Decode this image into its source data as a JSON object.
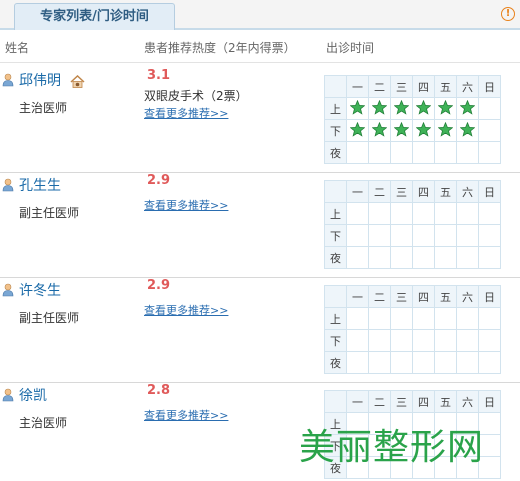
{
  "tab_label": "专家列表/门诊时间",
  "columns": {
    "name": "姓名",
    "rating": "患者推荐热度（2年内得票）",
    "clinic": "出诊时间"
  },
  "weekdays": [
    "一",
    "二",
    "三",
    "四",
    "五",
    "六",
    "日"
  ],
  "periods": [
    "上",
    "下",
    "夜"
  ],
  "more_link": "查看更多推荐>>",
  "doctors": [
    {
      "name": "邱伟明",
      "title": "主治医师",
      "score": "3.1",
      "votes": "双眼皮手术（2票）",
      "schedule": [
        [
          1,
          1,
          1,
          1,
          1,
          1,
          0
        ],
        [
          1,
          1,
          1,
          1,
          1,
          1,
          0
        ],
        [
          0,
          0,
          0,
          0,
          0,
          0,
          0
        ]
      ]
    },
    {
      "name": "孔生生",
      "title": "副主任医师",
      "score": "2.9",
      "votes": "",
      "schedule": [
        [
          0,
          0,
          0,
          0,
          0,
          0,
          0
        ],
        [
          0,
          0,
          0,
          0,
          0,
          0,
          0
        ],
        [
          0,
          0,
          0,
          0,
          0,
          0,
          0
        ]
      ]
    },
    {
      "name": "许冬生",
      "title": "副主任医师",
      "score": "2.9",
      "votes": "",
      "schedule": [
        [
          0,
          0,
          0,
          0,
          0,
          0,
          0
        ],
        [
          0,
          0,
          0,
          0,
          0,
          0,
          0
        ],
        [
          0,
          0,
          0,
          0,
          0,
          0,
          0
        ]
      ]
    },
    {
      "name": "徐凯",
      "title": "主治医师",
      "score": "2.8",
      "votes": "",
      "schedule": [
        [
          0,
          0,
          0,
          0,
          0,
          0,
          0
        ],
        [
          0,
          0,
          0,
          0,
          0,
          0,
          0
        ],
        [
          0,
          0,
          0,
          0,
          0,
          0,
          0
        ]
      ]
    }
  ],
  "watermark": "美丽整形网",
  "colors": {
    "star": "#2ea84a",
    "accent": "#1a6aa8",
    "score": "#e05a5a"
  }
}
